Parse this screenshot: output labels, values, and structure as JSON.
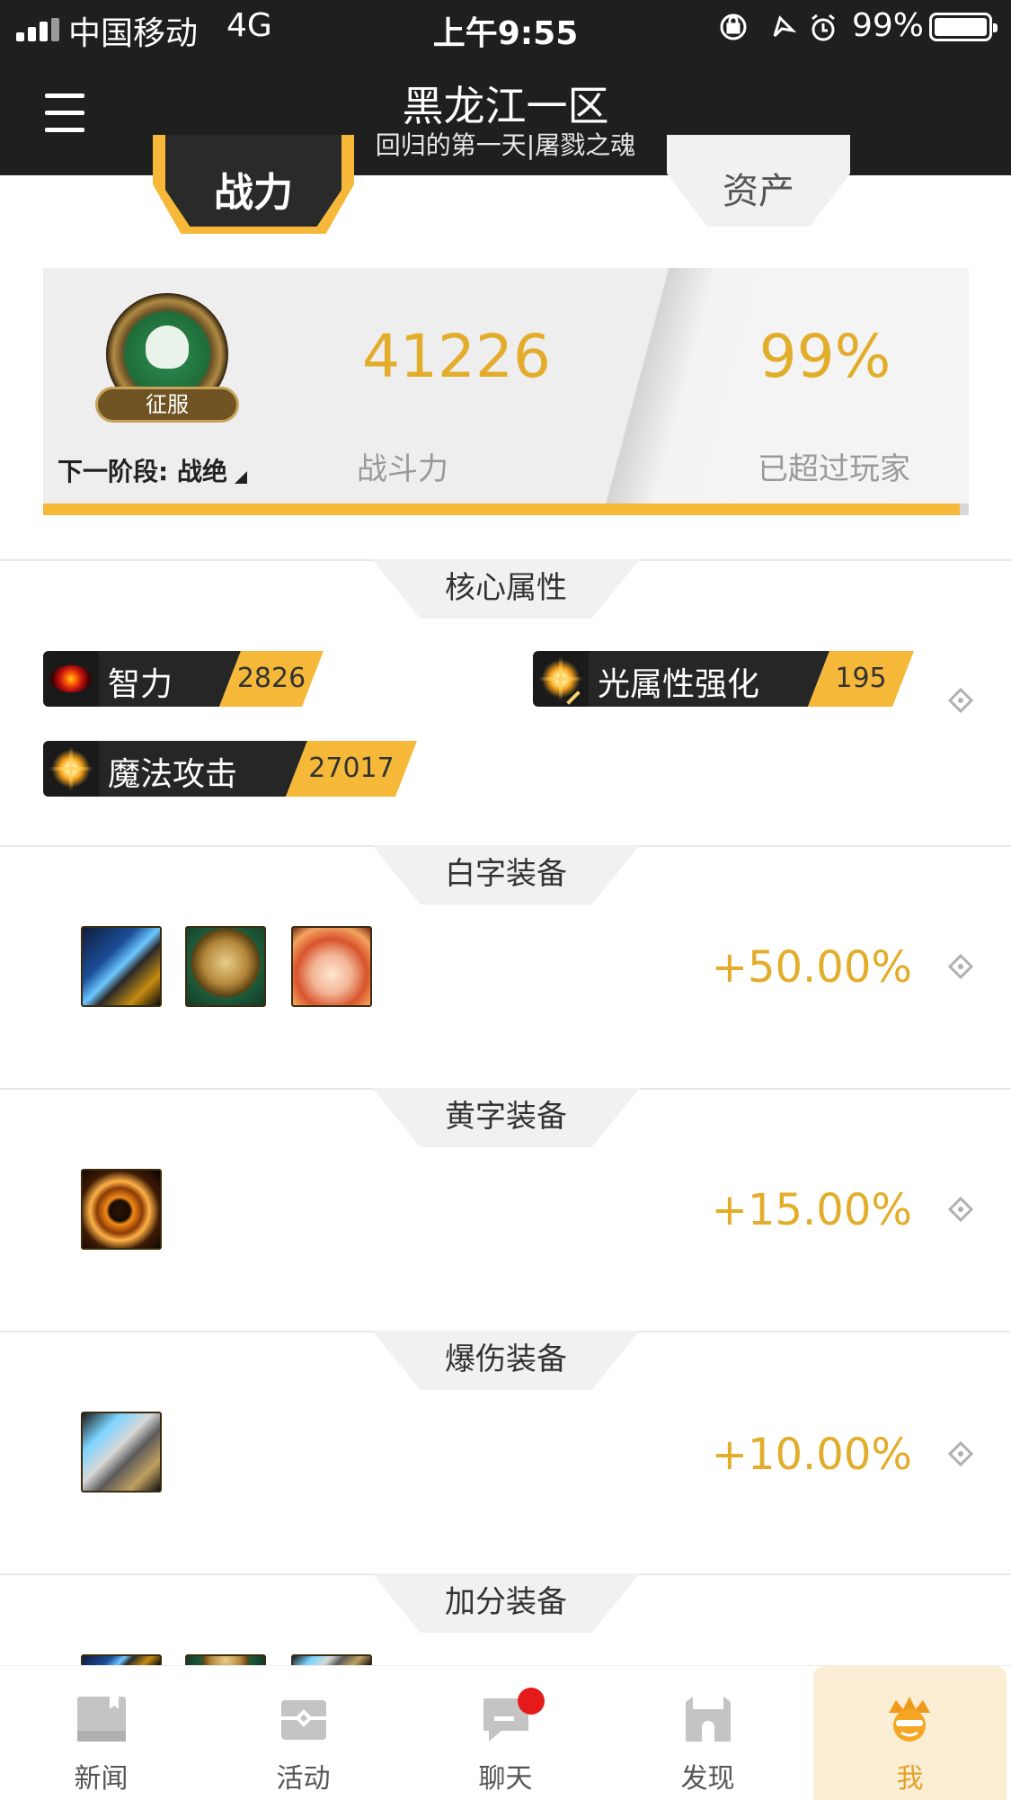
{
  "status_bar": {
    "carrier": "中国移动",
    "network": "4G",
    "time": "上午9:55",
    "battery": "99%",
    "icons": [
      "rotation-lock-icon",
      "location-icon",
      "alarm-icon"
    ]
  },
  "header": {
    "title": "黑龙江一区",
    "subtitle": "回归的第一天|屠戮之魂"
  },
  "tabs": [
    {
      "label": "战力",
      "active": true
    },
    {
      "label": "资产",
      "active": false
    }
  ],
  "power_card": {
    "emblem_label": "征服",
    "next_stage": "下一阶段: 战绝",
    "power_value": "41226",
    "power_label": "战斗力",
    "rank_value": "99%",
    "rank_label": "已超过玩家",
    "progress_fraction": 0.99
  },
  "core_attributes": {
    "title": "核心属性",
    "items": [
      {
        "name": "智力",
        "value": "2826",
        "icon": "evil-eye-icon"
      },
      {
        "name": "光属性强化",
        "value": "195",
        "icon": "light-sword-icon"
      },
      {
        "name": "魔法攻击",
        "value": "27017",
        "icon": "magic-spark-icon"
      }
    ]
  },
  "equipment_sections": [
    {
      "title": "白字装备",
      "bonus": "+50.00%",
      "icons": [
        "sword-icon",
        "lion-emblem-icon",
        "fox-girl-icon"
      ]
    },
    {
      "title": "黄字装备",
      "bonus": "+15.00%",
      "icons": [
        "fire-ring-icon"
      ]
    },
    {
      "title": "爆伤装备",
      "bonus": "+10.00%",
      "icons": [
        "armor-icon"
      ]
    },
    {
      "title": "加分装备",
      "icons": [
        "gear-icon-1",
        "gear-icon-2",
        "gear-icon-3"
      ]
    }
  ],
  "bottom_nav": {
    "items": [
      {
        "label": "新闻",
        "icon": "news-icon"
      },
      {
        "label": "活动",
        "icon": "gift-box-icon"
      },
      {
        "label": "聊天",
        "icon": "chat-icon",
        "badge": true
      },
      {
        "label": "发现",
        "icon": "castle-icon"
      },
      {
        "label": "我",
        "icon": "avatar-crown-icon",
        "active": true
      }
    ]
  },
  "colors": {
    "accent": "#e2ad2a",
    "chip_yellow": "#f5b838",
    "header_bg": "#1f1f1f",
    "chip_dark": "#262626"
  }
}
